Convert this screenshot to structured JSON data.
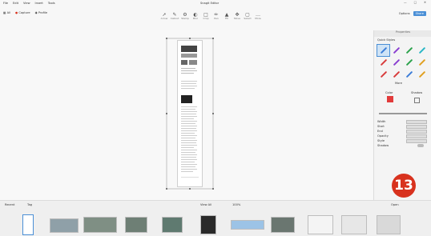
{
  "title_bar": {
    "menus": [
      "File",
      "Edit",
      "View",
      "Insert",
      "Tools"
    ],
    "window_title": "Snagit Editor",
    "window_controls": [
      "minimize-icon",
      "maximize-icon",
      "close-icon"
    ]
  },
  "toolbar": {
    "left_actions": [
      {
        "icon": "library-icon",
        "label": "All"
      },
      {
        "icon": "capture-icon",
        "label": "Capture"
      },
      {
        "icon": "profile-icon",
        "label": "Profile"
      }
    ],
    "tools": [
      {
        "icon": "arrow-icon",
        "label": "Arrow"
      },
      {
        "icon": "callout-icon",
        "label": "Callout"
      },
      {
        "icon": "stamp-icon",
        "label": "Stamp"
      },
      {
        "icon": "blur-icon",
        "label": "Blur"
      },
      {
        "icon": "crop-icon",
        "label": "Crop"
      },
      {
        "icon": "pen-icon",
        "label": "Pen"
      },
      {
        "icon": "fill-icon",
        "label": "Fill"
      },
      {
        "icon": "move-icon",
        "label": "Move"
      },
      {
        "icon": "selection-icon",
        "label": "Select"
      },
      {
        "icon": "more-icon",
        "label": "More"
      }
    ],
    "right_actions": {
      "options": "Options",
      "share": "Share"
    }
  },
  "sidebar": {
    "header": "Properties",
    "section_label": "Quick Styles",
    "styles": [
      {
        "color": "#3c7dd8"
      },
      {
        "color": "#8a3fd1"
      },
      {
        "color": "#2ba24c"
      },
      {
        "color": "#29b6c6"
      },
      {
        "color": "#d83c3c"
      },
      {
        "color": "#8a3fd1"
      },
      {
        "color": "#2ba24c"
      },
      {
        "color": "#e0a020"
      },
      {
        "color": "#d83c3c"
      },
      {
        "color": "#d83c3c"
      },
      {
        "color": "#3c7dd8"
      },
      {
        "color": "#e0a020"
      }
    ],
    "more_label": "More",
    "color_labels": {
      "fill": "Color",
      "outline": "Shadow"
    },
    "accent_color": "#e23b3b",
    "property_rows": [
      "Width",
      "Start",
      "End",
      "Opacity",
      "Style",
      "Shadow"
    ]
  },
  "filmstrip": {
    "left_label": "Recent",
    "tag_label": "Tag",
    "right_label": "Open",
    "view_label": "View All",
    "zoom_label": "100%"
  },
  "badge": {
    "number": "13"
  },
  "colors": {
    "accent": "#4a8fd6",
    "badge": "#d8321e"
  }
}
